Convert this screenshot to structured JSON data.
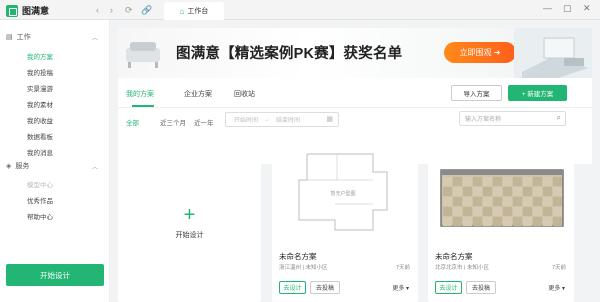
{
  "app": {
    "name": "图满意"
  },
  "titlebar": {
    "active_tab": "工作台"
  },
  "sidebar": {
    "section_work": "工作",
    "items_work": [
      {
        "label": "我的方案",
        "active": true
      },
      {
        "label": "我的投稿"
      },
      {
        "label": "实景漫游"
      },
      {
        "label": "我的素材"
      },
      {
        "label": "我的收益"
      },
      {
        "label": "数据看板"
      },
      {
        "label": "我的消息"
      }
    ],
    "section_service": "服务",
    "items_service": [
      {
        "label": "模型中心",
        "muted": true
      },
      {
        "label": "优秀作品"
      },
      {
        "label": "帮助中心"
      }
    ],
    "start_button": "开始设计"
  },
  "banner": {
    "title": "图满意【精选案例PK赛】获奖名单",
    "cta": "立即围观 ➜"
  },
  "tabs": [
    "我的方案",
    "企业方案",
    "回收站"
  ],
  "actions": {
    "import": "导入方案",
    "new": "+ 新建方案"
  },
  "filters": [
    "全部",
    "近三个月",
    "近一年"
  ],
  "date": {
    "start_placeholder": "开始时间",
    "end_placeholder": "结束时间",
    "sep": "→"
  },
  "search": {
    "placeholder": "输入方案名称"
  },
  "new_card": {
    "label": "开始设计"
  },
  "cards": [
    {
      "title": "未命名方案",
      "meta": "浙江温州 | 未知小区",
      "time": "7天前",
      "go": "去设计",
      "submit": "去投稿",
      "more": "更多 ▾",
      "thumb_label": "暂无户型图"
    },
    {
      "title": "未命名方案",
      "meta": "北京北京市 | 未知小区",
      "time": "7天前",
      "go": "去设计",
      "submit": "去投稿",
      "more": "更多 ▾"
    }
  ],
  "colors": {
    "accent": "#22b573",
    "cta": "#ff6a1a"
  }
}
